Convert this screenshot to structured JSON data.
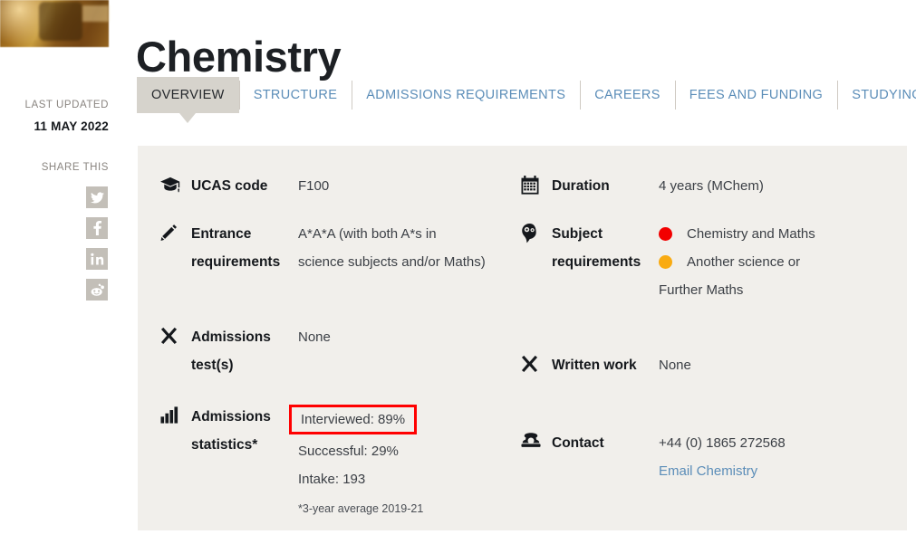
{
  "page": {
    "title": "Chemistry",
    "hero_image": "chemistry-hero-thumbnail"
  },
  "sidebar": {
    "last_updated_label": "LAST UPDATED",
    "last_updated_value": "11 MAY 2022",
    "share_label": "SHARE THIS",
    "share_links": [
      {
        "name": "twitter-share-icon",
        "title": "Twitter"
      },
      {
        "name": "facebook-share-icon",
        "title": "Facebook"
      },
      {
        "name": "linkedin-share-icon",
        "title": "LinkedIn"
      },
      {
        "name": "reddit-share-icon",
        "title": "Reddit"
      }
    ],
    "share_icon_bg": "#c3bfb8"
  },
  "tabs": [
    {
      "label": "OVERVIEW",
      "active": true
    },
    {
      "label": "STRUCTURE",
      "active": false
    },
    {
      "label": "ADMISSIONS REQUIREMENTS",
      "active": false
    },
    {
      "label": "CAREERS",
      "active": false
    },
    {
      "label": "FEES AND FUNDING",
      "active": false
    },
    {
      "label": "STUDYING AT OXFORD",
      "active": false
    }
  ],
  "overview": {
    "left": {
      "ucas": {
        "icon": "graduation-cap-icon",
        "label": "UCAS code",
        "value": "F100"
      },
      "entrance": {
        "icon": "pencil-icon",
        "label": "Entrance requirements",
        "line1": "A*A*A (with both A*s in",
        "line2": "science subjects and/or Maths)"
      },
      "admissions_test": {
        "icon": "cross-icon",
        "label": "Admissions test(s)",
        "value": "None"
      },
      "admissions_statistics": {
        "icon": "bar-chart-icon",
        "label": "Admissions statistics*",
        "interviewed": "Interviewed: 89%",
        "successful": "Successful: 29%",
        "intake": "Intake: 193",
        "footnote": "*3-year average 2019-21"
      }
    },
    "right": {
      "duration": {
        "icon": "calendar-icon",
        "label": "Duration",
        "value": "4 years (MChem)"
      },
      "subject_requirements": {
        "icon": "head-thinking-icon",
        "label": "Subject requirements",
        "items": [
          {
            "dot_color": "#f20000",
            "text": "Chemistry and Maths"
          },
          {
            "dot_color": "#f9ab12",
            "text": "Another science or"
          }
        ],
        "continuation": "Further Maths"
      },
      "written_work": {
        "icon": "cross-icon",
        "label": "Written work",
        "value": "None"
      },
      "contact": {
        "icon": "telephone-icon",
        "label": "Contact",
        "phone": "+44 (0) 1865 272568",
        "email_link": "Email Chemistry"
      }
    }
  },
  "colors": {
    "panel_bg": "#f1efeb",
    "active_tab_bg": "#d6d3cc",
    "link_blue": "#5b8db8",
    "highlight_outline": "#ff0000"
  }
}
